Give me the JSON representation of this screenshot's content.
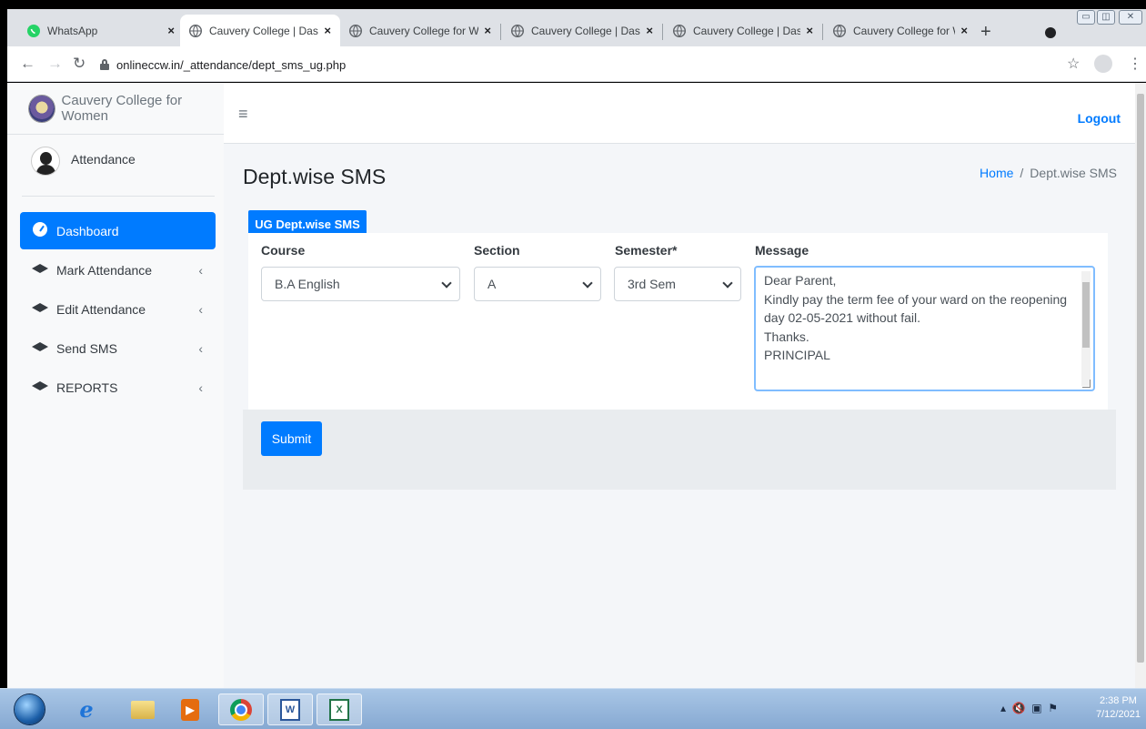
{
  "browser": {
    "tabs": [
      {
        "title": "WhatsApp",
        "favicon": "whatsapp-icon",
        "active": false
      },
      {
        "title": "Cauvery College | Dashb",
        "favicon": "globe-icon",
        "active": true
      },
      {
        "title": "Cauvery College for Wo",
        "favicon": "globe-icon",
        "active": false
      },
      {
        "title": "Cauvery College | Dashb",
        "favicon": "globe-icon",
        "active": false
      },
      {
        "title": "Cauvery College | Dashb",
        "favicon": "globe-icon",
        "active": false
      },
      {
        "title": "Cauvery College for Wo",
        "favicon": "globe-icon",
        "active": false
      }
    ],
    "tab_close": "×",
    "new_tab": "+",
    "url": "onlineccw.in/_attendance/dept_sms_ug.php"
  },
  "sidebar": {
    "brand": "Cauvery College for Women",
    "user_name": "Attendance",
    "items": [
      {
        "label": "Dashboard",
        "icon": "dashboard-icon",
        "active": true
      },
      {
        "label": "Mark Attendance",
        "icon": "graduation-cap-icon",
        "chevron": "‹"
      },
      {
        "label": "Edit Attendance",
        "icon": "graduation-cap-icon",
        "chevron": "‹"
      },
      {
        "label": "Send SMS",
        "icon": "graduation-cap-icon",
        "chevron": "‹"
      },
      {
        "label": "REPORTS",
        "icon": "graduation-cap-icon",
        "chevron": "‹"
      }
    ]
  },
  "topnav": {
    "logout": "Logout"
  },
  "header": {
    "title": "Dept.wise SMS",
    "breadcrumb": {
      "home": "Home",
      "separator": "/",
      "current": "Dept.wise SMS"
    }
  },
  "form": {
    "tab_label": "UG Dept.wise SMS",
    "course": {
      "label": "Course",
      "value": "B.A English"
    },
    "section": {
      "label": "Section",
      "value": "A"
    },
    "semester": {
      "label": "Semester*",
      "value": "3rd Sem"
    },
    "message": {
      "label": "Message",
      "lines": [
        "Dear Parent,",
        "Kindly pay the term fee of your ward on the reopening day 02-05-2021 without fail.",
        "Thanks.",
        "PRINCIPAL"
      ]
    },
    "submit_label": "Submit"
  },
  "taskbar": {
    "time": "2:38 PM",
    "date": "7/12/2021",
    "apps": [
      "internet-explorer-icon",
      "file-explorer-icon",
      "media-player-icon",
      "chrome-icon",
      "word-icon",
      "excel-icon"
    ]
  },
  "colors": {
    "accent": "#007bff",
    "sidebar_bg": "#f8f9fa",
    "content_bg": "#f4f6f9"
  }
}
